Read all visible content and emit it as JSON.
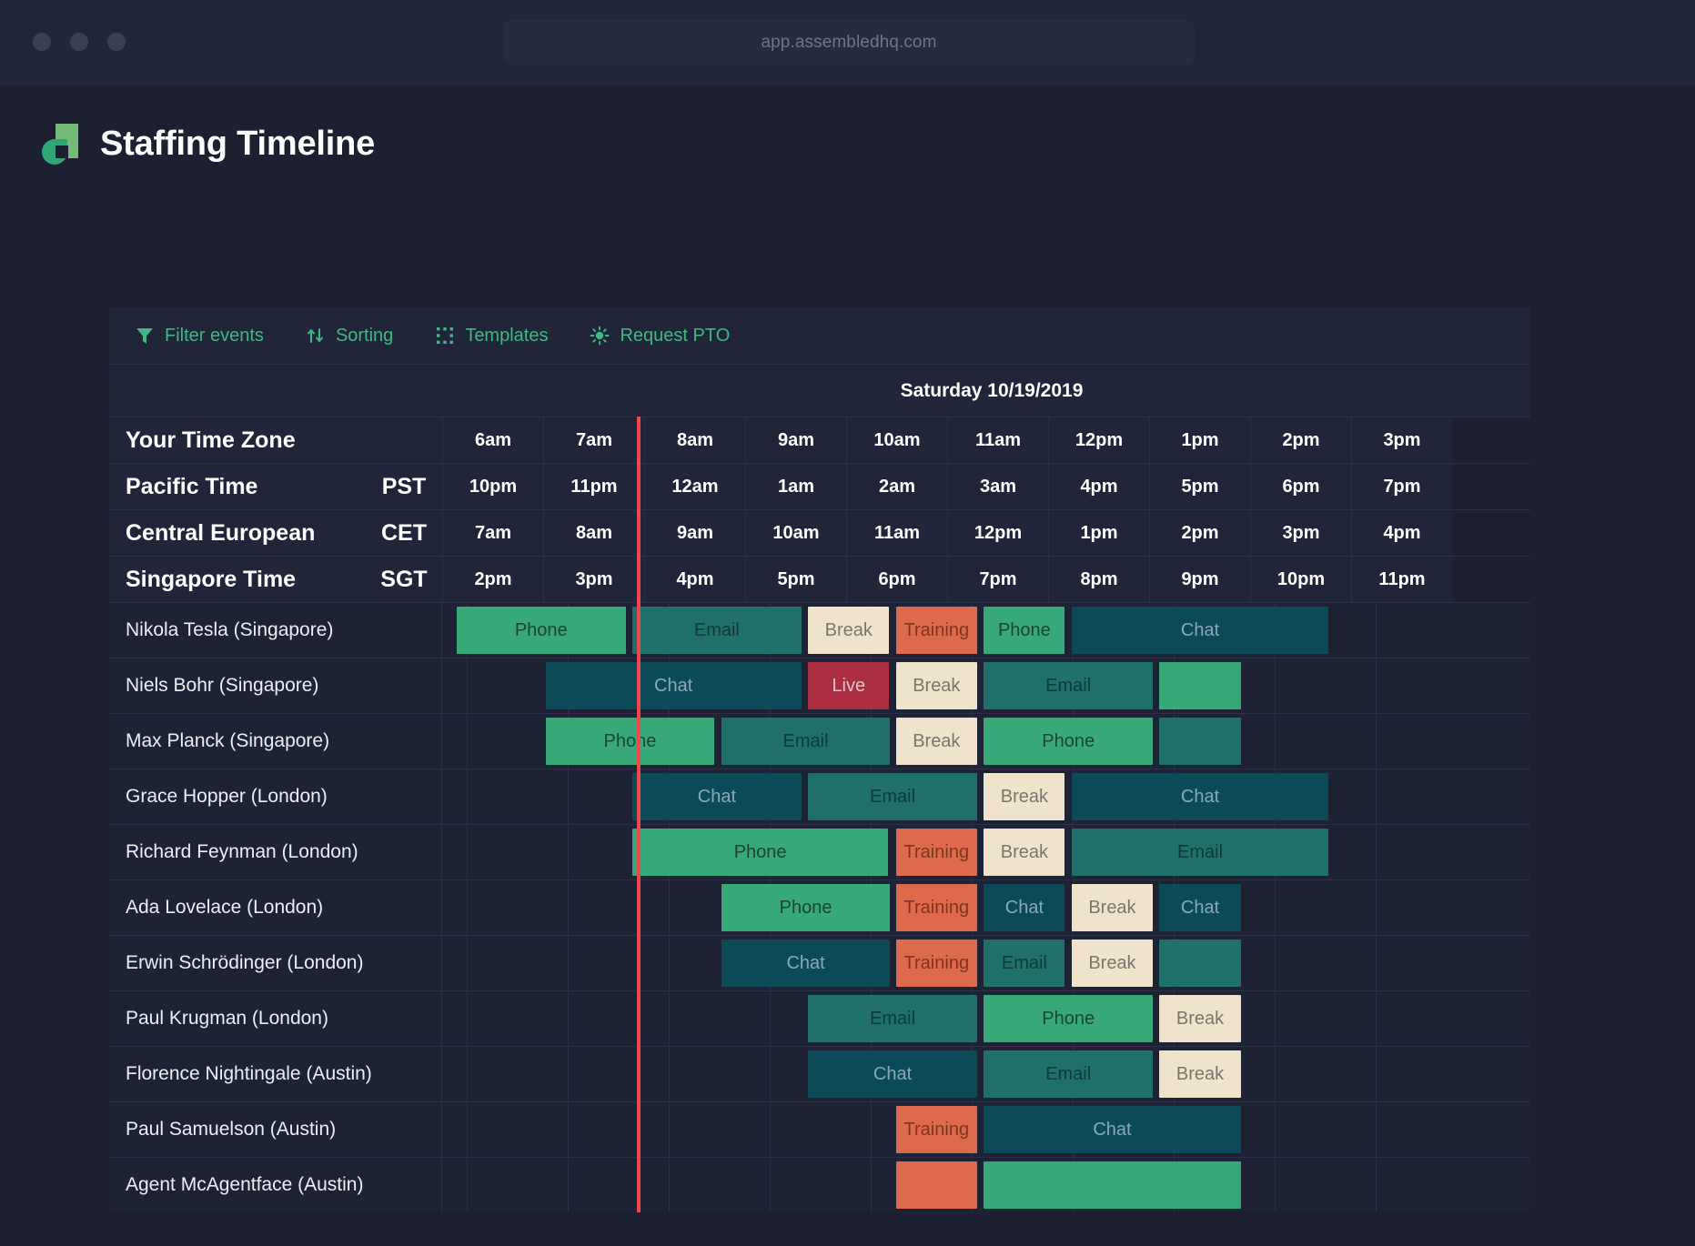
{
  "browser": {
    "url": "app.assembledhq.com",
    "traffic_lights": [
      "close",
      "minimize",
      "maximize"
    ]
  },
  "header": {
    "title": "Staffing Timeline",
    "logo_name": "assembled-logo",
    "accent_green": "#3fb883",
    "logo_green_light": "#74b975",
    "logo_green_dark": "#2fa678"
  },
  "toolbar": {
    "buttons": [
      {
        "label": "Filter events",
        "icon": "funnel-icon"
      },
      {
        "label": "Sorting",
        "icon": "sort-arrows-icon"
      },
      {
        "label": "Templates",
        "icon": "dotted-grid-icon"
      },
      {
        "label": "Request PTO",
        "icon": "sun-icon"
      }
    ]
  },
  "date_bar": {
    "date": "Saturday 10/19/2019"
  },
  "timezones": [
    {
      "name": "Your Time Zone",
      "abbr": "",
      "hours": [
        "6am",
        "7am",
        "8am",
        "9am",
        "10am",
        "11am",
        "12pm",
        "1pm",
        "2pm",
        "3pm"
      ]
    },
    {
      "name": "Pacific Time",
      "abbr": "PST",
      "hours": [
        "10pm",
        "11pm",
        "12am",
        "1am",
        "2am",
        "3am",
        "4pm",
        "5pm",
        "6pm",
        "7pm"
      ]
    },
    {
      "name": "Central European",
      "abbr": "CET",
      "hours": [
        "7am",
        "8am",
        "9am",
        "10am",
        "11am",
        "12pm",
        "1pm",
        "2pm",
        "3pm",
        "4pm"
      ]
    },
    {
      "name": "Singapore Time",
      "abbr": "SGT",
      "hours": [
        "2pm",
        "3pm",
        "4pm",
        "5pm",
        "6pm",
        "7pm",
        "8pm",
        "9pm",
        "10pm",
        "11pm"
      ]
    }
  ],
  "now_indicator": {
    "color": "#f1474a",
    "at_hour_fraction": 2.7
  },
  "event_colors": {
    "Phone": "#37a878",
    "Email": "#1f706b",
    "Chat": "#0d4a58",
    "Break": "#f0e3cc",
    "Training": "#dd6a4d",
    "Live": "#ab2e42"
  },
  "agents": [
    {
      "name": "Nikola Tesla (Singapore)",
      "events": [
        {
          "label": "Phone",
          "type": "phone",
          "start": 0.9,
          "span": 1.7
        },
        {
          "label": "Email",
          "type": "email",
          "start": 2.64,
          "span": 1.7
        },
        {
          "label": "Break",
          "type": "break",
          "start": 4.38,
          "span": 0.83
        },
        {
          "label": "Training",
          "type": "training",
          "start": 5.25,
          "span": 0.83
        },
        {
          "label": "Phone",
          "type": "phone",
          "start": 6.12,
          "span": 0.83
        },
        {
          "label": "Chat",
          "type": "chat",
          "start": 6.99,
          "span": 2.57
        }
      ]
    },
    {
      "name": "Niels Bohr (Singapore)",
      "events": [
        {
          "label": "Chat",
          "type": "chat",
          "start": 1.78,
          "span": 2.56
        },
        {
          "label": "Live",
          "type": "live",
          "start": 4.38,
          "span": 0.83
        },
        {
          "label": "Break",
          "type": "break",
          "start": 5.25,
          "span": 0.83
        },
        {
          "label": "Email",
          "type": "email",
          "start": 6.12,
          "span": 1.7
        },
        {
          "label": "",
          "type": "phone",
          "start": 7.86,
          "span": 0.83
        }
      ]
    },
    {
      "name": "Max Planck (Singapore)",
      "events": [
        {
          "label": "Phone",
          "type": "phone",
          "start": 1.78,
          "span": 1.7
        },
        {
          "label": "Email",
          "type": "email",
          "start": 3.52,
          "span": 1.7
        },
        {
          "label": "Break",
          "type": "break",
          "start": 5.25,
          "span": 0.83
        },
        {
          "label": "Phone",
          "type": "phone",
          "start": 6.12,
          "span": 1.7
        },
        {
          "label": "",
          "type": "email",
          "start": 7.86,
          "span": 0.83
        }
      ]
    },
    {
      "name": "Grace Hopper (London)",
      "events": [
        {
          "label": "Chat",
          "type": "chat",
          "start": 2.64,
          "span": 1.7
        },
        {
          "label": "Email",
          "type": "email",
          "start": 4.38,
          "span": 1.7
        },
        {
          "label": "Break",
          "type": "break",
          "start": 6.12,
          "span": 0.83
        },
        {
          "label": "Chat",
          "type": "chat",
          "start": 6.99,
          "span": 2.57
        }
      ]
    },
    {
      "name": "Richard Feynman (London)",
      "events": [
        {
          "label": "Phone",
          "type": "phone",
          "start": 2.64,
          "span": 2.56
        },
        {
          "label": "Training",
          "type": "training",
          "start": 5.25,
          "span": 0.83
        },
        {
          "label": "Break",
          "type": "break",
          "start": 6.12,
          "span": 0.83
        },
        {
          "label": "Email",
          "type": "email",
          "start": 6.99,
          "span": 2.57
        }
      ]
    },
    {
      "name": "Ada Lovelace (London)",
      "events": [
        {
          "label": "Phone",
          "type": "phone",
          "start": 3.52,
          "span": 1.7
        },
        {
          "label": "Training",
          "type": "training",
          "start": 5.25,
          "span": 0.83
        },
        {
          "label": "Chat",
          "type": "chat",
          "start": 6.12,
          "span": 0.83
        },
        {
          "label": "Break",
          "type": "break",
          "start": 6.99,
          "span": 0.83
        },
        {
          "label": "Chat",
          "type": "chat",
          "start": 7.86,
          "span": 0.83
        }
      ]
    },
    {
      "name": "Erwin Schrödinger (London)",
      "events": [
        {
          "label": "Chat",
          "type": "chat",
          "start": 3.52,
          "span": 1.7
        },
        {
          "label": "Training",
          "type": "training",
          "start": 5.25,
          "span": 0.83
        },
        {
          "label": "Email",
          "type": "email",
          "start": 6.12,
          "span": 0.83
        },
        {
          "label": "Break",
          "type": "break",
          "start": 6.99,
          "span": 0.83
        },
        {
          "label": "",
          "type": "email",
          "start": 7.86,
          "span": 0.83
        }
      ]
    },
    {
      "name": "Paul Krugman (London)",
      "events": [
        {
          "label": "Email",
          "type": "email",
          "start": 4.38,
          "span": 1.7
        },
        {
          "label": "Phone",
          "type": "phone",
          "start": 6.12,
          "span": 1.7
        },
        {
          "label": "Break",
          "type": "break",
          "start": 7.86,
          "span": 0.83
        }
      ]
    },
    {
      "name": "Florence Nightingale (Austin)",
      "events": [
        {
          "label": "Chat",
          "type": "chat",
          "start": 4.38,
          "span": 1.7
        },
        {
          "label": "Email",
          "type": "email",
          "start": 6.12,
          "span": 1.7
        },
        {
          "label": "Break",
          "type": "break",
          "start": 7.86,
          "span": 0.83
        }
      ]
    },
    {
      "name": "Paul Samuelson (Austin)",
      "events": [
        {
          "label": "Training",
          "type": "training",
          "start": 5.25,
          "span": 0.83
        },
        {
          "label": "Chat",
          "type": "chat",
          "start": 6.12,
          "span": 2.57
        }
      ]
    },
    {
      "name": "Agent McAgentface (Austin)",
      "events": [
        {
          "label": "",
          "type": "training",
          "start": 5.25,
          "span": 0.83
        },
        {
          "label": "",
          "type": "phone",
          "start": 6.12,
          "span": 2.57
        }
      ]
    }
  ]
}
